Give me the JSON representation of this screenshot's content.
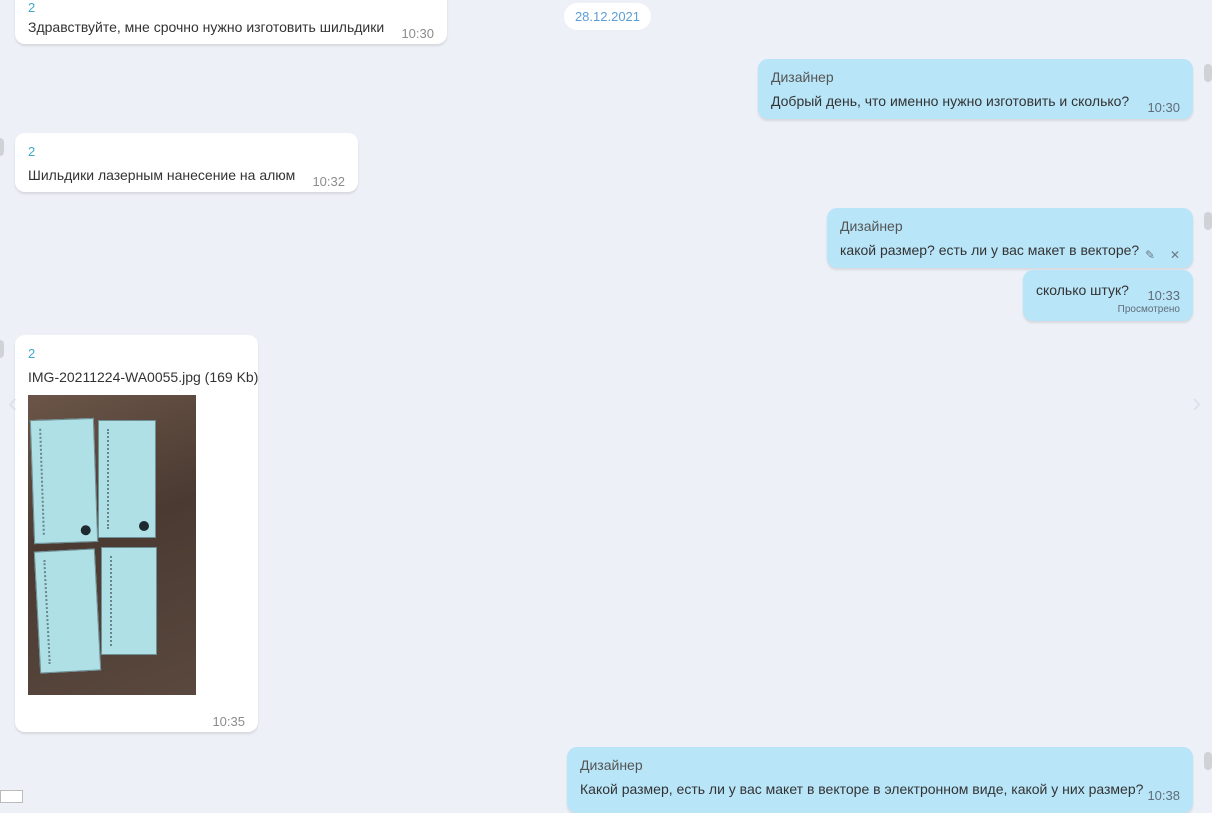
{
  "chat": {
    "date": "28.12.2021",
    "messages": [
      {
        "type": "in",
        "author": "2",
        "text": "Здравствуйте, мне срочно нужно изготовить шильдики",
        "time": "10:30"
      },
      {
        "type": "out",
        "author": "Дизайнер",
        "text": "Добрый день, что именно нужно изготовить и сколько?",
        "time": "10:30"
      },
      {
        "type": "in",
        "author": "2",
        "text": "Шильдики лазерным нанесение на алюм",
        "time": "10:32"
      },
      {
        "type": "out",
        "author": "Дизайнер",
        "text": "какой размер? есть ли у вас макет в векторе?",
        "time": ""
      },
      {
        "type": "out",
        "author": "",
        "text": "сколько штук?",
        "time": "10:33",
        "status": "Просмотрено"
      },
      {
        "type": "in",
        "author": "2",
        "text": "IMG-20211224-WA0055.jpg (169 Kb)",
        "time": "10:35"
      },
      {
        "type": "out",
        "author": "Дизайнер",
        "text": "Какой размер, есть ли у вас макет в векторе в электронном виде, какой у них размер?",
        "time": "10:38"
      }
    ]
  },
  "icons": {
    "edit": "pencil-icon",
    "delete": "close-icon",
    "prev": "chevron-left-icon",
    "next": "chevron-right-icon"
  },
  "glyphs": {
    "edit": "✎",
    "delete": "✕",
    "prev": "‹",
    "next": "›"
  },
  "colors": {
    "background": "#eef0f7",
    "incoming": "#ffffff",
    "outgoing": "#b8e5f8",
    "author_incoming": "#3fa9c7"
  }
}
